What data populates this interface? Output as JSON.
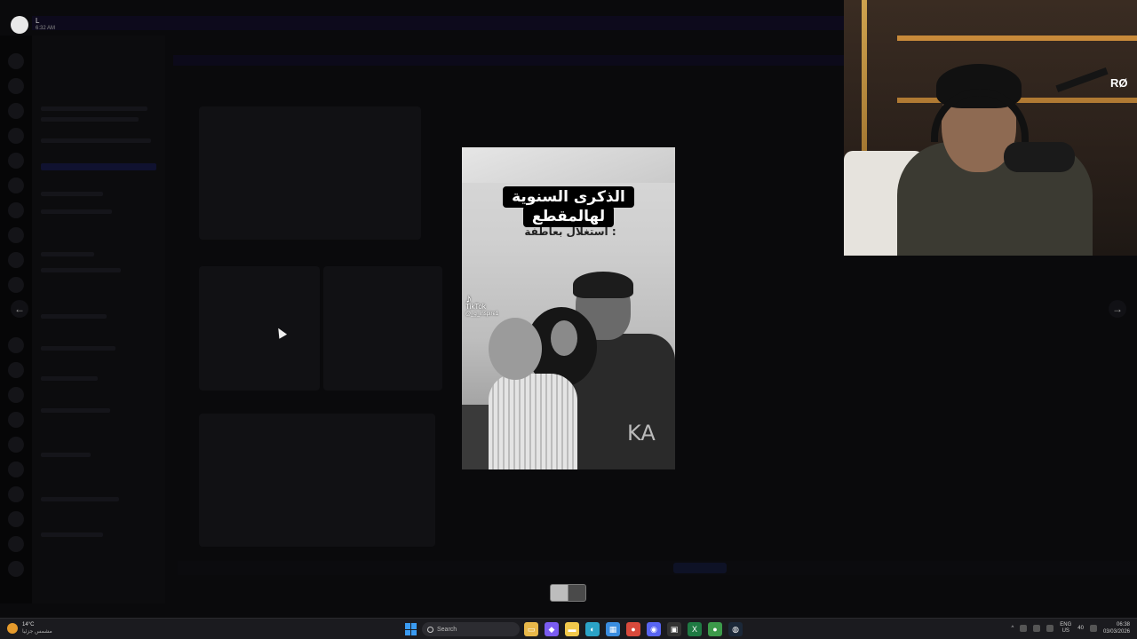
{
  "uploader": {
    "name": "L",
    "time": "6:32 AM"
  },
  "media": {
    "caption_line1": "الذكرى السنوية",
    "caption_line2": "لهالمقطع",
    "caption_sub": "استغلال بعاطفة :",
    "watermark_app": "TikTok",
    "watermark_handle": "@_g_inspire1",
    "shirt_print": "KA"
  },
  "navigation": {
    "prev_icon": "arrow-left-icon",
    "next_icon": "arrow-right-icon",
    "prev_glyph": "←",
    "next_glyph": "→"
  },
  "webcam": {
    "brand_text": "RØ"
  },
  "taskbar": {
    "weather_temp": "14°C",
    "weather_desc": "مشمس جزئيا",
    "search_placeholder": "Search",
    "lang_primary": "ENG",
    "lang_secondary": "US",
    "volume_label": "40",
    "clock_time": "06:38",
    "clock_date": "03/03/2026",
    "apps": [
      {
        "name": "file-explorer-icon",
        "glyph": "▭",
        "color": "#e8b84a"
      },
      {
        "name": "copilot-icon",
        "glyph": "◆",
        "color": "#7a5cf0"
      },
      {
        "name": "folder-icon",
        "glyph": "▬",
        "color": "#f2c94c"
      },
      {
        "name": "edge-icon",
        "glyph": "◐",
        "color": "#2ba3c7"
      },
      {
        "name": "store-icon",
        "glyph": "▦",
        "color": "#3a8de0"
      },
      {
        "name": "chrome-icon",
        "glyph": "●",
        "color": "#d94a3c"
      },
      {
        "name": "discord-icon",
        "glyph": "◉",
        "color": "#5865f2"
      },
      {
        "name": "media-icon",
        "glyph": "▣",
        "color": "#333"
      },
      {
        "name": "excel-icon",
        "glyph": "X",
        "color": "#1f7a43"
      },
      {
        "name": "chrome-alt-icon",
        "glyph": "●",
        "color": "#3c9a4a"
      },
      {
        "name": "steam-icon",
        "glyph": "◍",
        "color": "#1b2838"
      }
    ]
  }
}
